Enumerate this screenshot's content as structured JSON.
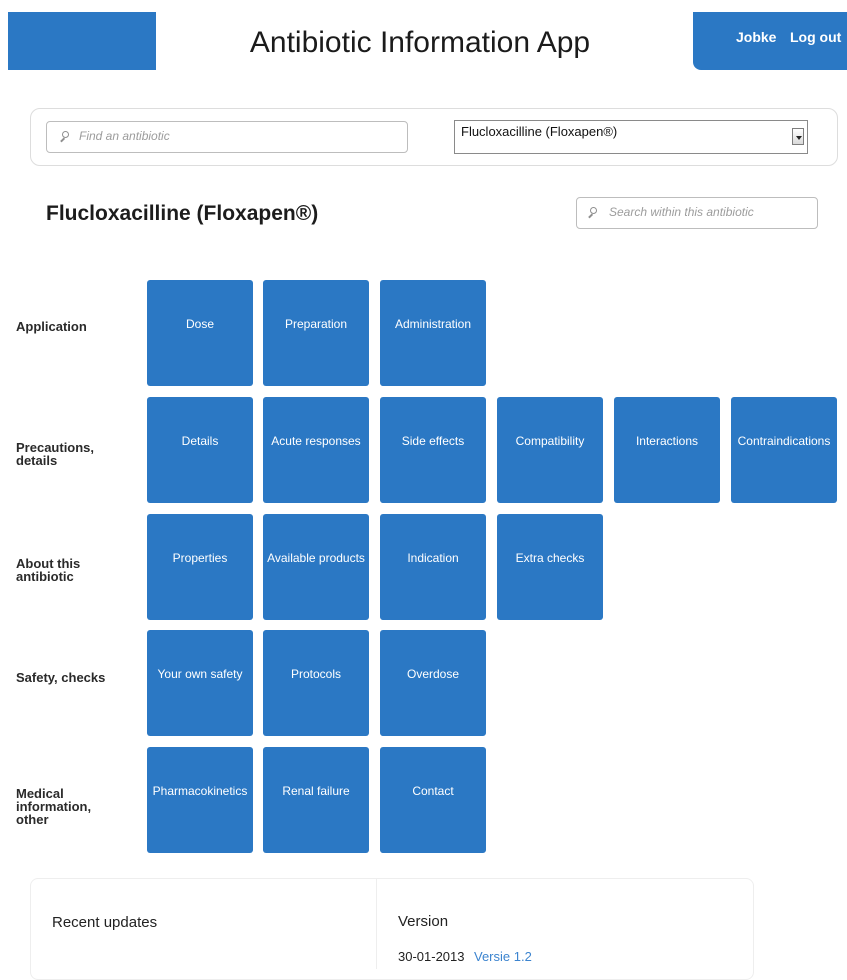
{
  "header": {
    "title": "Antibiotic Information App",
    "user_name": "Jobke",
    "logout_label": "Log out"
  },
  "search": {
    "find_placeholder": "Find an antibiotic",
    "selected_antibiotic": "Flucloxacilline (Floxapen®)"
  },
  "antibiotic": {
    "title": "Flucloxacilline (Floxapen®)",
    "search_placeholder": "Search within this antibiotic"
  },
  "categories": [
    {
      "label": "Application",
      "tiles": [
        "Dose",
        "Preparation",
        "Administration"
      ]
    },
    {
      "label": "Precautions, details",
      "tiles": [
        "Details",
        "Acute responses",
        "Side effects",
        "Compatibility",
        "Interactions",
        "Contraindications"
      ]
    },
    {
      "label": "About this antibiotic",
      "tiles": [
        "Properties",
        "Available products",
        "Indication",
        "Extra checks"
      ]
    },
    {
      "label": "Safety, checks",
      "tiles": [
        "Your own safety",
        "Protocols",
        "Overdose"
      ]
    },
    {
      "label": "Medical information, other",
      "tiles": [
        "Pharmacokinetics",
        "Renal failure",
        "Contact"
      ]
    }
  ],
  "footer": {
    "recent_updates_title": "Recent updates",
    "version_title": "Version",
    "version_date": "30-01-2013",
    "version_link": "Versie 1.2"
  },
  "colors": {
    "accent": "#2b78c4",
    "link": "#3c84cf"
  }
}
